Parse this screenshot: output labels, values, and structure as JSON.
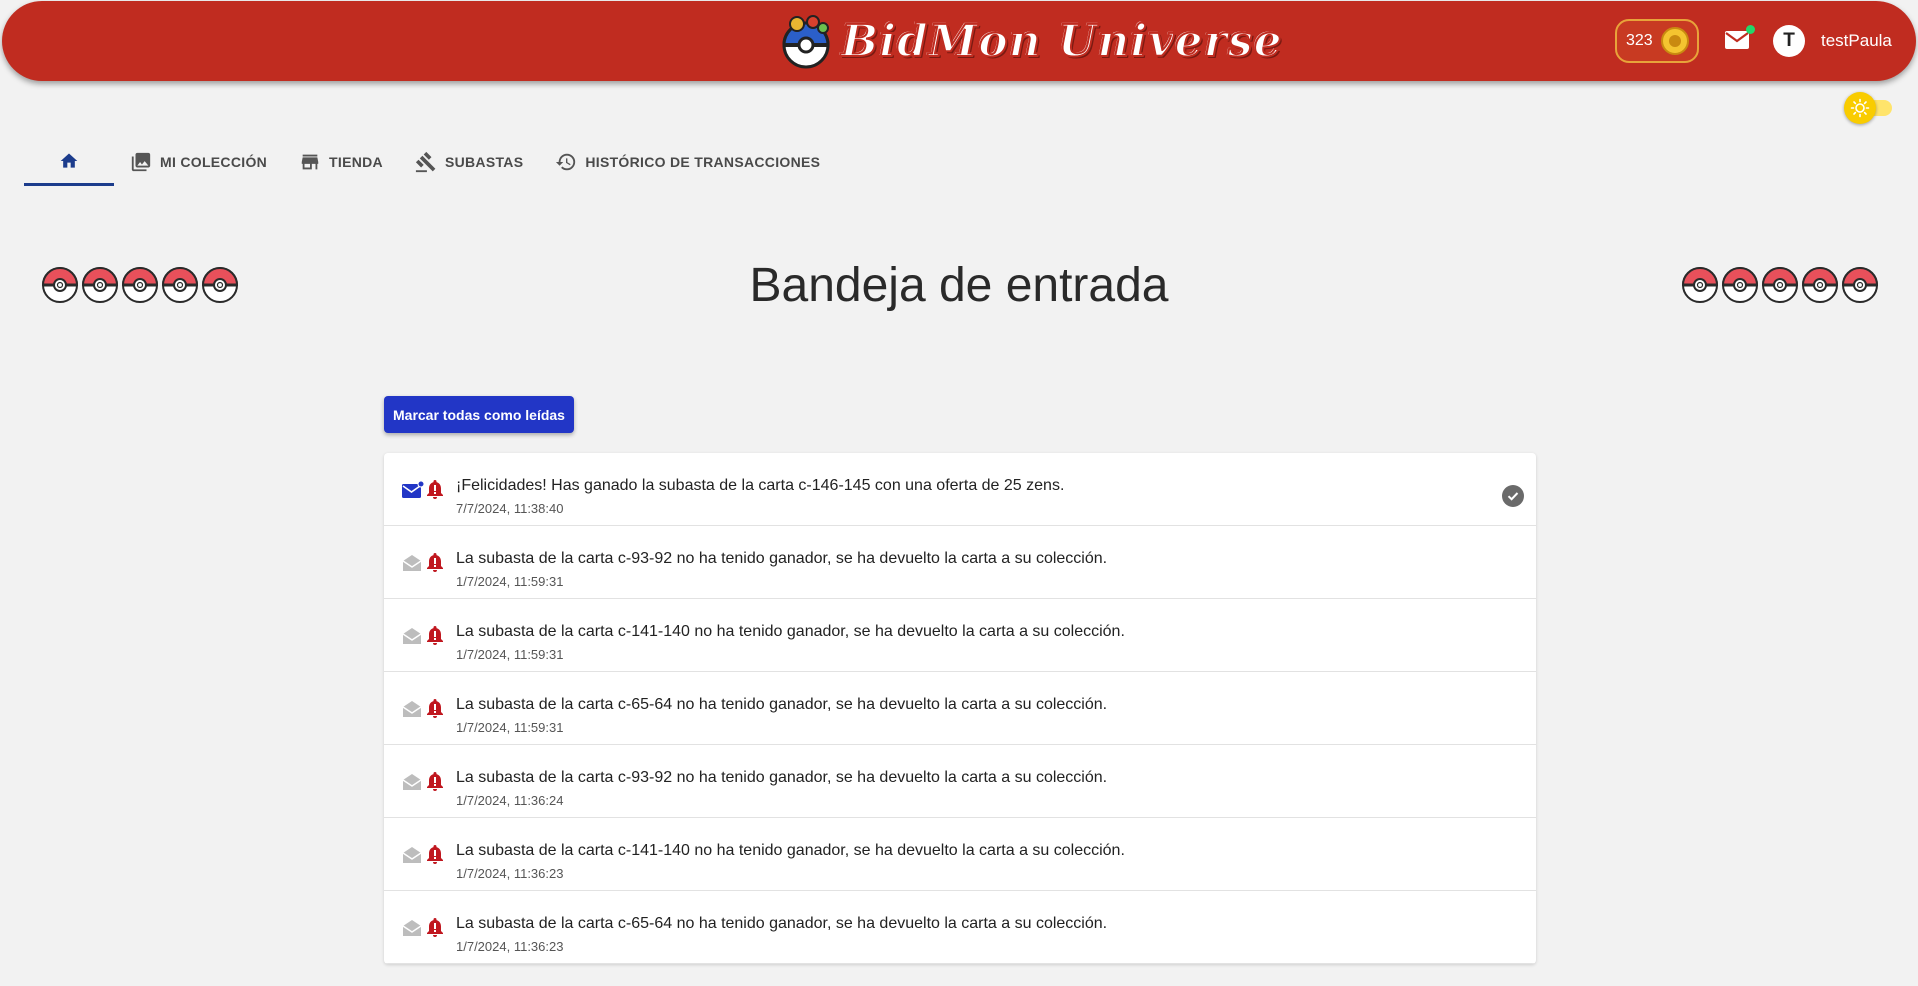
{
  "header": {
    "logo_text": "BidMon Universe",
    "coins": "323",
    "avatar_letter": "T",
    "username": "testPaula"
  },
  "tabs": [
    {
      "label": "",
      "icon": "home-icon"
    },
    {
      "label": "MI COLECCIÓN",
      "icon": "photo-library-icon"
    },
    {
      "label": "TIENDA",
      "icon": "store-icon"
    },
    {
      "label": "SUBASTAS",
      "icon": "gavel-icon"
    },
    {
      "label": "HISTÓRICO DE TRANSACCIONES",
      "icon": "history-icon"
    }
  ],
  "page": {
    "title": "Bandeja de entrada",
    "mark_all_read_label": "Marcar todas como leídas"
  },
  "messages": [
    {
      "text": "¡Felicidades! Has ganado la subasta de la carta c-146-145 con una oferta de 25 zens.",
      "date": "7/7/2024, 11:38:40",
      "read": false
    },
    {
      "text": "La subasta de la carta c-93-92 no ha tenido ganador, se ha devuelto la carta a su colección.",
      "date": "1/7/2024, 11:59:31",
      "read": true
    },
    {
      "text": "La subasta de la carta c-141-140 no ha tenido ganador, se ha devuelto la carta a su colección.",
      "date": "1/7/2024, 11:59:31",
      "read": true
    },
    {
      "text": "La subasta de la carta c-65-64 no ha tenido ganador, se ha devuelto la carta a su colección.",
      "date": "1/7/2024, 11:59:31",
      "read": true
    },
    {
      "text": "La subasta de la carta c-93-92 no ha tenido ganador, se ha devuelto la carta a su colección.",
      "date": "1/7/2024, 11:36:24",
      "read": true
    },
    {
      "text": "La subasta de la carta c-141-140 no ha tenido ganador, se ha devuelto la carta a su colección.",
      "date": "1/7/2024, 11:36:23",
      "read": true
    },
    {
      "text": "La subasta de la carta c-65-64 no ha tenido ganador, se ha devuelto la carta a su colección.",
      "date": "1/7/2024, 11:36:23",
      "read": true
    }
  ],
  "colors": {
    "header": "#c02c20",
    "primary": "#2236c6",
    "tab_indicator": "#1c3c8c",
    "alert": "#c0171f"
  }
}
